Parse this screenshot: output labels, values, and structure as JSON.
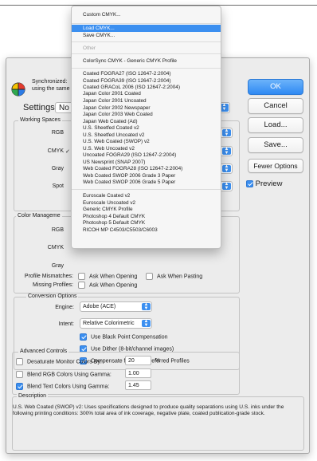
{
  "dialog": {
    "sync_line1": "Synchronized:",
    "sync_line2": "using the same"
  },
  "buttons": {
    "ok": "OK",
    "cancel": "Cancel",
    "load": "Load...",
    "save": "Save...",
    "fewer": "Fewer Options",
    "preview": "Preview"
  },
  "settings": {
    "label": "Settings:",
    "value": "No"
  },
  "working_spaces": {
    "title": "Working Spaces",
    "rgb": "RGB",
    "cmyk": "CMYK",
    "cmyk_mark": "✓",
    "gray": "Gray",
    "spot": "Spot"
  },
  "color_management": {
    "title": "Color Manageme",
    "rgb": "RGB",
    "cmyk": "CMYK",
    "gray": "Gray",
    "profile_mismatches": "Profile Mismatches:",
    "pm_ask_open": "Ask When Opening",
    "pm_ask_paste": "Ask When Pasting",
    "missing_profiles": "Missing Profiles:",
    "mp_ask_open": "Ask When Opening"
  },
  "conversion": {
    "title": "Conversion Options",
    "engine_label": "Engine:",
    "engine_value": "Adobe (ACE)",
    "intent_label": "Intent:",
    "intent_value": "Relative Colorimetric",
    "black_point": "Use Black Point Compensation",
    "dither": "Use Dither (8-bit/channel images)",
    "compensate": "Compensate for Scene-referred Profiles"
  },
  "advanced": {
    "title": "Advanced Controls",
    "desaturate": "Desaturate Monitor Colors By:",
    "desaturate_value": "20",
    "desaturate_unit": "%",
    "blend_rgb": "Blend RGB Colors Using Gamma:",
    "blend_rgb_value": "1.00",
    "blend_text": "Blend Text Colors Using Gamma:",
    "blend_text_value": "1.45"
  },
  "description": {
    "title": "Description",
    "text": "U.S. Web Coated (SWOP) v2:  Uses specifications designed to produce quality separations using U.S. inks under the following printing conditions: 300% total area of ink coverage, negative plate, coated publication-grade stock."
  },
  "menu": {
    "items": [
      "Custom CMYK...",
      "Load CMYK...",
      "Save CMYK...",
      "Other",
      "ColorSync CMYK - Generic CMYK Profile",
      "Coated FOGRA27 (ISO 12647-2:2004)",
      "Coated FOGRA39 (ISO 12647-2:2004)",
      "Coated GRACoL 2006 (ISO 12647-2:2004)",
      "Japan Color 2001 Coated",
      "Japan Color 2001 Uncoated",
      "Japan Color 2002 Newspaper",
      "Japan Color 2003 Web Coated",
      "Japan Web Coated (Ad)",
      "U.S. Sheetfed Coated v2",
      "U.S. Sheetfed Uncoated v2",
      "U.S. Web Coated (SWOP) v2",
      "U.S. Web Uncoated v2",
      "Uncoated FOGRA29 (ISO 12647-2:2004)",
      "US Newsprint (SNAP 2007)",
      "Web Coated FOGRA28 (ISO 12647-2:2004)",
      "Web Coated SWOP 2006 Grade 3 Paper",
      "Web Coated SWOP 2006 Grade 5 Paper",
      "Euroscale Coated v2",
      "Euroscale Uncoated v2",
      "Generic CMYK Profile",
      "Photoshop 4 Default CMYK",
      "Photoshop 5 Default CMYK",
      "RICOH MP C4503/C5503/C6003"
    ]
  },
  "colors": {
    "accent": "#3b8ff0",
    "window_bg": "#ececec"
  }
}
